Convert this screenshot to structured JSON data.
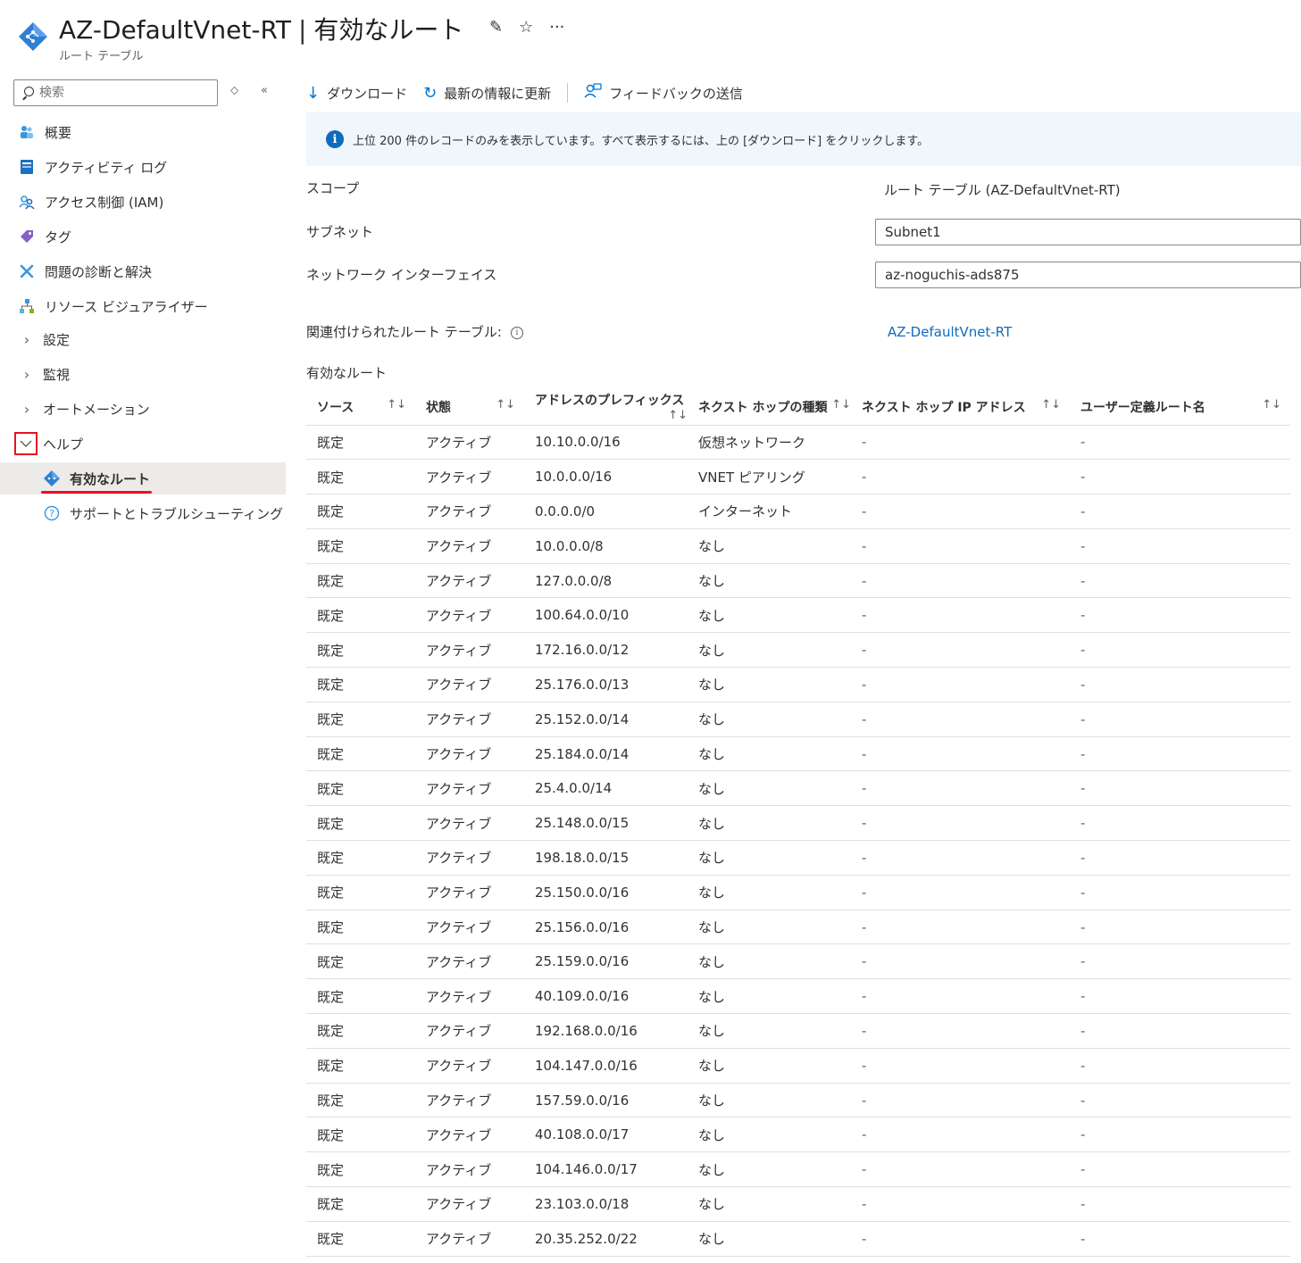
{
  "header": {
    "title": "AZ-DefaultVnet-RT",
    "separator": "|",
    "page": "有効なルート",
    "subtitle": "ルート テーブル",
    "pin_glyph": "✎",
    "star_glyph": "☆",
    "more_glyph": "···"
  },
  "sidebar": {
    "search_placeholder": "検索",
    "items": [
      {
        "label": "概要",
        "icon": "overview-icon"
      },
      {
        "label": "アクティビティ ログ",
        "icon": "activity-log-icon"
      },
      {
        "label": "アクセス制御 (IAM)",
        "icon": "iam-icon"
      },
      {
        "label": "タグ",
        "icon": "tag-icon"
      },
      {
        "label": "問題の診断と解決",
        "icon": "diagnose-icon"
      },
      {
        "label": "リソース ビジュアライザー",
        "icon": "visualizer-icon"
      },
      {
        "label": "設定",
        "icon": "chevron-right-icon"
      },
      {
        "label": "監視",
        "icon": "chevron-right-icon"
      },
      {
        "label": "オートメーション",
        "icon": "chevron-right-icon"
      },
      {
        "label": "ヘルプ",
        "icon": "chevron-down-icon"
      },
      {
        "label": "有効なルート",
        "icon": "route-table-icon"
      },
      {
        "label": "サポートとトラブルシューティング",
        "icon": "help-circle-icon"
      }
    ]
  },
  "toolbar": {
    "download": "ダウンロード",
    "refresh": "最新の情報に更新",
    "feedback": "フィードバックの送信"
  },
  "info": {
    "message": "上位 200 件のレコードのみを表示しています。すべて表示するには、上の [ダウンロード] をクリックします。"
  },
  "fields": {
    "scope_label": "スコープ",
    "scope_value": "ルート テーブル (AZ-DefaultVnet-RT)",
    "subnet_label": "サブネット",
    "subnet_value": "Subnet1",
    "nic_label": "ネットワーク インターフェイス",
    "nic_value": "az-noguchis-ads875",
    "assoc_label": "関連付けられたルート テーブル:",
    "assoc_value": "AZ-DefaultVnet-RT"
  },
  "routes": {
    "section_title": "有効なルート",
    "sort_glyph": "↑↓",
    "columns": [
      "ソース",
      "状態",
      "アドレスのプレフィックス",
      "ネクスト ホップの種類",
      "ネクスト ホップ IP アドレス",
      "ユーザー定義ルート名"
    ],
    "rows": [
      [
        "既定",
        "アクティブ",
        "10.10.0.0/16",
        "仮想ネットワーク",
        "-",
        "-"
      ],
      [
        "既定",
        "アクティブ",
        "10.0.0.0/16",
        "VNET ピアリング",
        "-",
        "-"
      ],
      [
        "既定",
        "アクティブ",
        "0.0.0.0/0",
        "インターネット",
        "-",
        "-"
      ],
      [
        "既定",
        "アクティブ",
        "10.0.0.0/8",
        "なし",
        "-",
        "-"
      ],
      [
        "既定",
        "アクティブ",
        "127.0.0.0/8",
        "なし",
        "-",
        "-"
      ],
      [
        "既定",
        "アクティブ",
        "100.64.0.0/10",
        "なし",
        "-",
        "-"
      ],
      [
        "既定",
        "アクティブ",
        "172.16.0.0/12",
        "なし",
        "-",
        "-"
      ],
      [
        "既定",
        "アクティブ",
        "25.176.0.0/13",
        "なし",
        "-",
        "-"
      ],
      [
        "既定",
        "アクティブ",
        "25.152.0.0/14",
        "なし",
        "-",
        "-"
      ],
      [
        "既定",
        "アクティブ",
        "25.184.0.0/14",
        "なし",
        "-",
        "-"
      ],
      [
        "既定",
        "アクティブ",
        "25.4.0.0/14",
        "なし",
        "-",
        "-"
      ],
      [
        "既定",
        "アクティブ",
        "25.148.0.0/15",
        "なし",
        "-",
        "-"
      ],
      [
        "既定",
        "アクティブ",
        "198.18.0.0/15",
        "なし",
        "-",
        "-"
      ],
      [
        "既定",
        "アクティブ",
        "25.150.0.0/16",
        "なし",
        "-",
        "-"
      ],
      [
        "既定",
        "アクティブ",
        "25.156.0.0/16",
        "なし",
        "-",
        "-"
      ],
      [
        "既定",
        "アクティブ",
        "25.159.0.0/16",
        "なし",
        "-",
        "-"
      ],
      [
        "既定",
        "アクティブ",
        "40.109.0.0/16",
        "なし",
        "-",
        "-"
      ],
      [
        "既定",
        "アクティブ",
        "192.168.0.0/16",
        "なし",
        "-",
        "-"
      ],
      [
        "既定",
        "アクティブ",
        "104.147.0.0/16",
        "なし",
        "-",
        "-"
      ],
      [
        "既定",
        "アクティブ",
        "157.59.0.0/16",
        "なし",
        "-",
        "-"
      ],
      [
        "既定",
        "アクティブ",
        "40.108.0.0/17",
        "なし",
        "-",
        "-"
      ],
      [
        "既定",
        "アクティブ",
        "104.146.0.0/17",
        "なし",
        "-",
        "-"
      ],
      [
        "既定",
        "アクティブ",
        "23.103.0.0/18",
        "なし",
        "-",
        "-"
      ],
      [
        "既定",
        "アクティブ",
        "20.35.252.0/22",
        "なし",
        "-",
        "-"
      ]
    ]
  },
  "colors": {
    "accent": "#0078d4",
    "link": "#0f6cbd",
    "info_bg": "#eff6fc",
    "highlight_red": "#e81123"
  }
}
